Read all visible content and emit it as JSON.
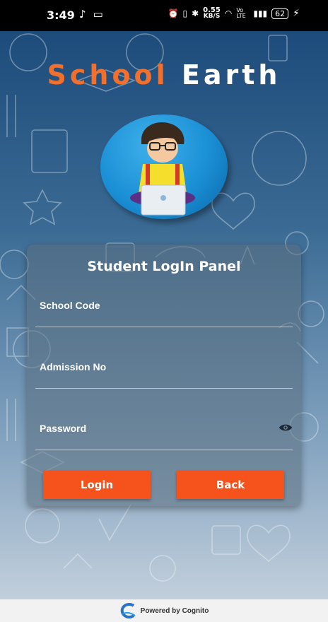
{
  "status_bar": {
    "time": "3:49",
    "speed_value": "0.55",
    "speed_unit": "KB/S",
    "network": "Vo LTE",
    "battery": "62"
  },
  "brand": {
    "word1": "School",
    "word2": "Earth"
  },
  "login_panel": {
    "title": "Student LogIn Panel",
    "school_code_label": "School Code",
    "school_code_value": "",
    "admission_no_label": "Admission No",
    "admission_no_value": "",
    "password_label": "Password",
    "password_value": "",
    "login_button": "Login",
    "back_button": "Back"
  },
  "footer": {
    "text": "Powered by Cognito"
  },
  "colors": {
    "accent": "#f6521c",
    "brand_orange": "#f36f2c",
    "background": "#1e4a78"
  }
}
